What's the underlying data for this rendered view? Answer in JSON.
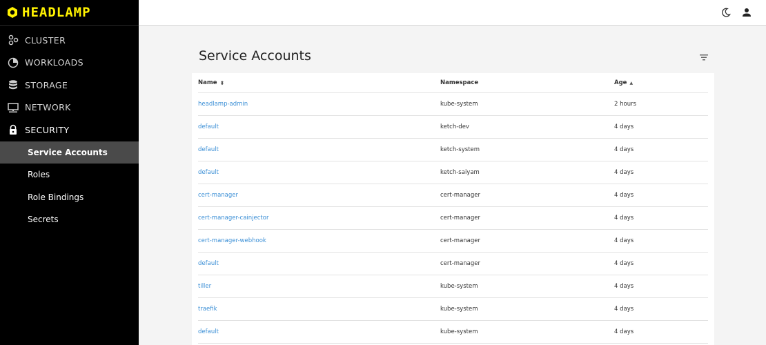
{
  "brand": {
    "name": "HEADLAMP"
  },
  "sidebar": {
    "items": [
      {
        "label": "CLUSTER",
        "icon": "cluster-icon"
      },
      {
        "label": "WORKLOADS",
        "icon": "workloads-icon"
      },
      {
        "label": "STORAGE",
        "icon": "storage-icon"
      },
      {
        "label": "NETWORK",
        "icon": "network-icon"
      },
      {
        "label": "SECURITY",
        "icon": "lock-icon"
      }
    ],
    "sub_items": [
      {
        "label": "Service Accounts",
        "active": true
      },
      {
        "label": "Roles"
      },
      {
        "label": "Role Bindings"
      },
      {
        "label": "Secrets"
      }
    ]
  },
  "topbar": {
    "icons": [
      "theme-toggle-icon",
      "user-icon"
    ]
  },
  "main": {
    "title": "Service Accounts",
    "table": {
      "headers": {
        "name": "Name",
        "namespace": "Namespace",
        "age": "Age"
      },
      "rows": [
        {
          "name": "headlamp-admin",
          "namespace": "kube-system",
          "age": "2 hours"
        },
        {
          "name": "default",
          "namespace": "ketch-dev",
          "age": "4 days"
        },
        {
          "name": "default",
          "namespace": "ketch-system",
          "age": "4 days"
        },
        {
          "name": "default",
          "namespace": "ketch-saiyam",
          "age": "4 days"
        },
        {
          "name": "cert-manager",
          "namespace": "cert-manager",
          "age": "4 days"
        },
        {
          "name": "cert-manager-cainjector",
          "namespace": "cert-manager",
          "age": "4 days"
        },
        {
          "name": "cert-manager-webhook",
          "namespace": "cert-manager",
          "age": "4 days"
        },
        {
          "name": "default",
          "namespace": "cert-manager",
          "age": "4 days"
        },
        {
          "name": "tiller",
          "namespace": "kube-system",
          "age": "4 days"
        },
        {
          "name": "traefik",
          "namespace": "kube-system",
          "age": "4 days"
        },
        {
          "name": "default",
          "namespace": "kube-system",
          "age": "4 days"
        }
      ]
    }
  },
  "colors": {
    "accent_yellow": "#fff200",
    "link": "#3b8fd6",
    "sidebar_bg": "#000000",
    "active_bg": "#4a4a4a"
  }
}
